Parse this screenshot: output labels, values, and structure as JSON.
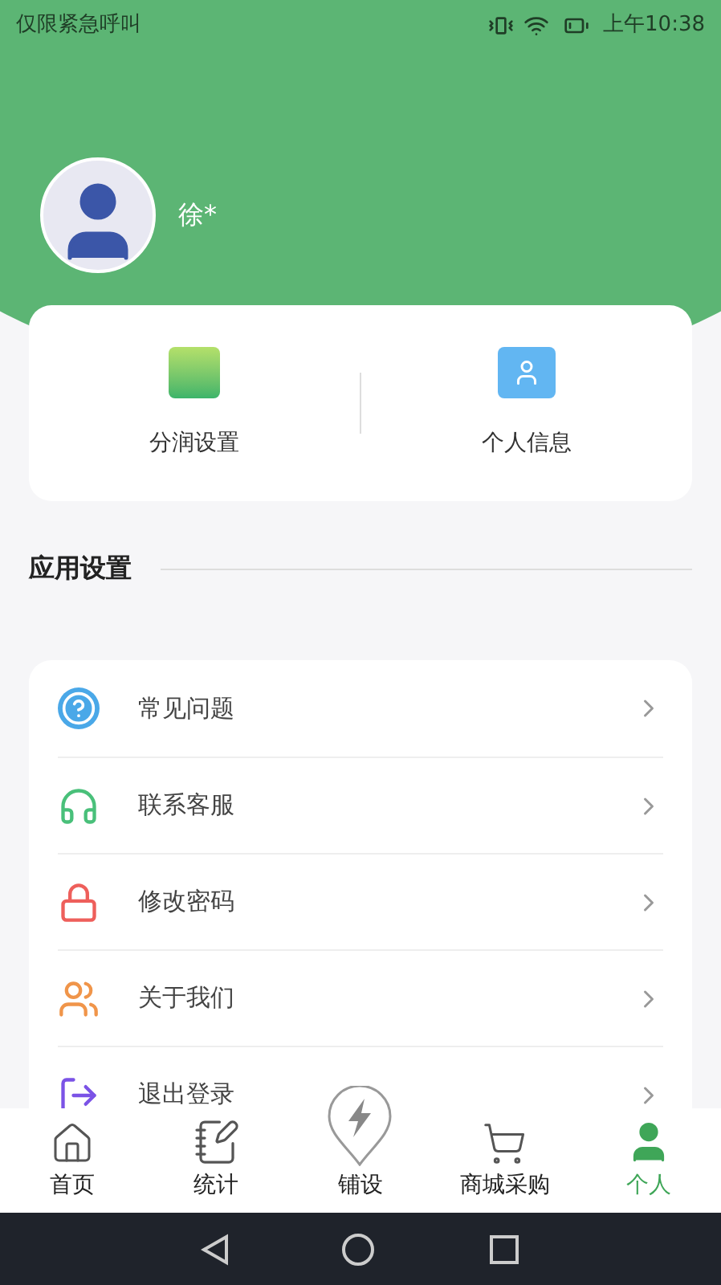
{
  "status_bar": {
    "notice": "仅限紧急呼叫",
    "time": "上午10:38"
  },
  "profile": {
    "name": "徐*"
  },
  "shortcuts": [
    {
      "label": "分润设置"
    },
    {
      "label": "个人信息"
    }
  ],
  "section_title": "应用设置",
  "menu": [
    {
      "label": "常见问题"
    },
    {
      "label": "联系客服"
    },
    {
      "label": "修改密码"
    },
    {
      "label": "关于我们"
    },
    {
      "label": "退出登录"
    }
  ],
  "tabs": [
    {
      "label": "首页",
      "selected": false
    },
    {
      "label": "统计",
      "selected": false
    },
    {
      "label": "铺设",
      "selected": false
    },
    {
      "label": "商城采购",
      "selected": false
    },
    {
      "label": "个人",
      "selected": true
    }
  ]
}
